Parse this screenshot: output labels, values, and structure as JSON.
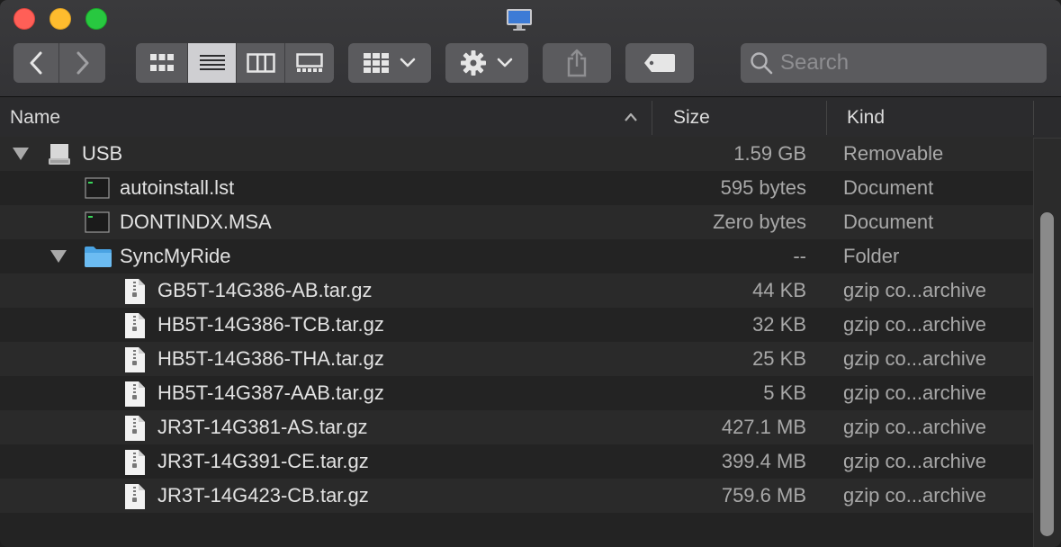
{
  "search": {
    "placeholder": "Search"
  },
  "columns": {
    "name": "Name",
    "size": "Size",
    "kind": "Kind"
  },
  "rows": [
    {
      "name": "USB",
      "size": "1.59 GB",
      "kind": "Removable",
      "icon": "drive-icon",
      "indent": 0,
      "disclosure": "expanded"
    },
    {
      "name": "autoinstall.lst",
      "size": "595 bytes",
      "kind": "Document",
      "icon": "document-icon",
      "indent": 1,
      "disclosure": "none"
    },
    {
      "name": "DONTINDX.MSA",
      "size": "Zero bytes",
      "kind": "Document",
      "icon": "document-icon",
      "indent": 1,
      "disclosure": "none"
    },
    {
      "name": "SyncMyRide",
      "size": "--",
      "kind": "Folder",
      "icon": "folder-icon",
      "indent": 1,
      "disclosure": "expanded"
    },
    {
      "name": "GB5T-14G386-AB.tar.gz",
      "size": "44 KB",
      "kind": "gzip co...archive",
      "icon": "archive-icon",
      "indent": 2,
      "disclosure": "none"
    },
    {
      "name": "HB5T-14G386-TCB.tar.gz",
      "size": "32 KB",
      "kind": "gzip co...archive",
      "icon": "archive-icon",
      "indent": 2,
      "disclosure": "none"
    },
    {
      "name": "HB5T-14G386-THA.tar.gz",
      "size": "25 KB",
      "kind": "gzip co...archive",
      "icon": "archive-icon",
      "indent": 2,
      "disclosure": "none"
    },
    {
      "name": "HB5T-14G387-AAB.tar.gz",
      "size": "5 KB",
      "kind": "gzip co...archive",
      "icon": "archive-icon",
      "indent": 2,
      "disclosure": "none"
    },
    {
      "name": "JR3T-14G381-AS.tar.gz",
      "size": "427.1 MB",
      "kind": "gzip co...archive",
      "icon": "archive-icon",
      "indent": 2,
      "disclosure": "none"
    },
    {
      "name": "JR3T-14G391-CE.tar.gz",
      "size": "399.4 MB",
      "kind": "gzip co...archive",
      "icon": "archive-icon",
      "indent": 2,
      "disclosure": "none"
    },
    {
      "name": "JR3T-14G423-CB.tar.gz",
      "size": "759.6 MB",
      "kind": "gzip co...archive",
      "icon": "archive-icon",
      "indent": 2,
      "disclosure": "none"
    }
  ],
  "colors": {
    "accent_folder": "#5fb3f0",
    "close": "#ff5f57",
    "minimize": "#febc2e",
    "maximize": "#28c840"
  }
}
